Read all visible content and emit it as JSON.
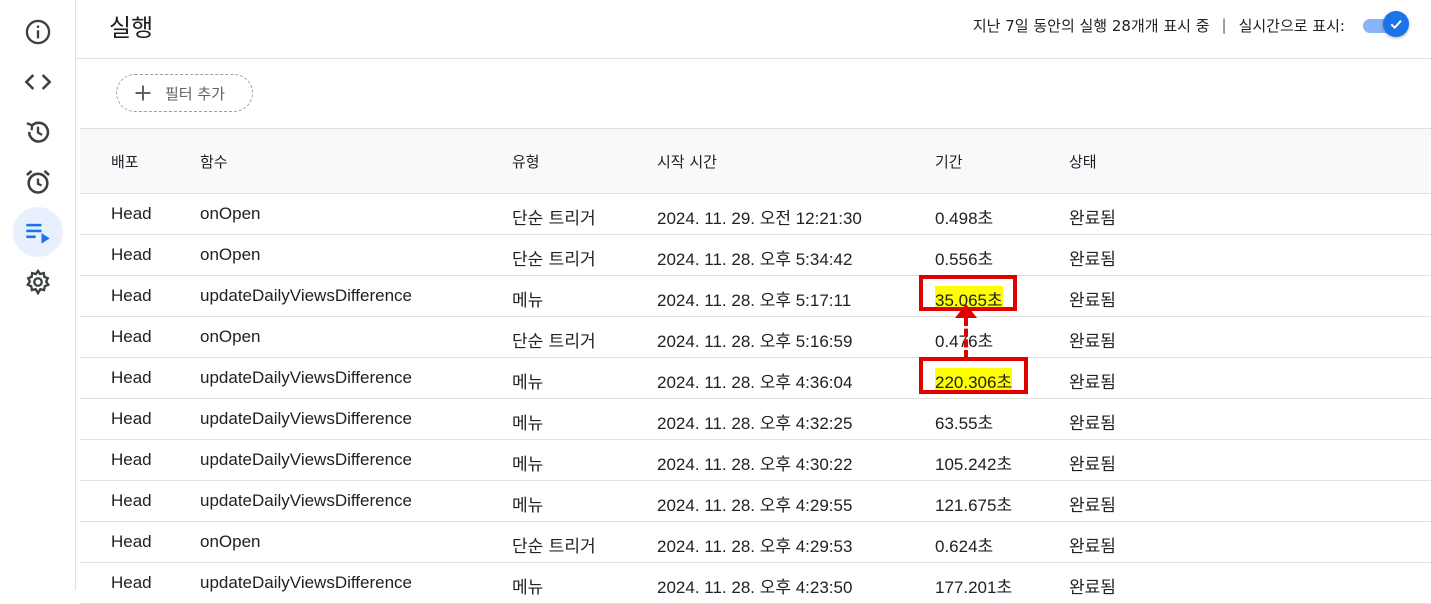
{
  "header": {
    "title": "실행",
    "showing_text": "지난 7일 동안의 실행 28개개 표시 중",
    "separator": "|",
    "realtime_label": "실시간으로 표시:",
    "realtime_enabled": true
  },
  "sidebar": {
    "items": [
      {
        "icon": "info-icon"
      },
      {
        "icon": "code-icon"
      },
      {
        "icon": "history-icon"
      },
      {
        "icon": "alarm-icon"
      },
      {
        "icon": "executions-icon",
        "active": true
      },
      {
        "icon": "gear-icon"
      }
    ]
  },
  "filter": {
    "label": "필터 추가"
  },
  "table": {
    "headers": [
      "배포",
      "함수",
      "유형",
      "시작 시간",
      "기간",
      "상태"
    ],
    "rows": [
      {
        "deploy": "Head",
        "function": "onOpen",
        "type": "단순 트리거",
        "start": "2024. 11. 29. 오전 12:21:30",
        "duration": "0.498초",
        "status": "완료됨"
      },
      {
        "deploy": "Head",
        "function": "onOpen",
        "type": "단순 트리거",
        "start": "2024. 11. 28. 오후 5:34:42",
        "duration": "0.556초",
        "status": "완료됨"
      },
      {
        "deploy": "Head",
        "function": "updateDailyViewsDifference",
        "type": "메뉴",
        "start": "2024. 11. 28. 오후 5:17:11",
        "duration": "35.065초",
        "status": "완료됨"
      },
      {
        "deploy": "Head",
        "function": "onOpen",
        "type": "단순 트리거",
        "start": "2024. 11. 28. 오후 5:16:59",
        "duration": "0.476초",
        "status": "완료됨"
      },
      {
        "deploy": "Head",
        "function": "updateDailyViewsDifference",
        "type": "메뉴",
        "start": "2024. 11. 28. 오후 4:36:04",
        "duration": "220.306초",
        "status": "완료됨"
      },
      {
        "deploy": "Head",
        "function": "updateDailyViewsDifference",
        "type": "메뉴",
        "start": "2024. 11. 28. 오후 4:32:25",
        "duration": "63.55초",
        "status": "완료됨"
      },
      {
        "deploy": "Head",
        "function": "updateDailyViewsDifference",
        "type": "메뉴",
        "start": "2024. 11. 28. 오후 4:30:22",
        "duration": "105.242초",
        "status": "완료됨"
      },
      {
        "deploy": "Head",
        "function": "updateDailyViewsDifference",
        "type": "메뉴",
        "start": "2024. 11. 28. 오후 4:29:55",
        "duration": "121.675초",
        "status": "완료됨"
      },
      {
        "deploy": "Head",
        "function": "onOpen",
        "type": "단순 트리거",
        "start": "2024. 11. 28. 오후 4:29:53",
        "duration": "0.624초",
        "status": "완료됨"
      },
      {
        "deploy": "Head",
        "function": "updateDailyViewsDifference",
        "type": "메뉴",
        "start": "2024. 11. 28. 오후 4:23:50",
        "duration": "177.201초",
        "status": "완료됨"
      }
    ]
  },
  "annotation": {
    "highlight_color": "#ffff00",
    "box_color": "#e00000",
    "highlighted_rows": [
      2,
      4
    ]
  }
}
